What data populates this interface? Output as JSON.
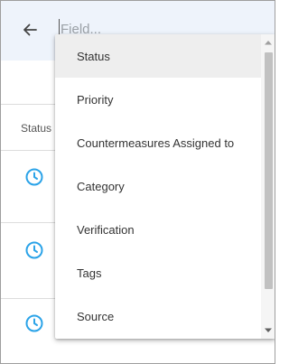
{
  "search": {
    "placeholder": "Field..."
  },
  "table": {
    "column_header": "Status"
  },
  "dropdown": {
    "items": [
      {
        "label": "Status"
      },
      {
        "label": "Priority"
      },
      {
        "label": "Countermeasures Assigned to"
      },
      {
        "label": "Category"
      },
      {
        "label": "Verification"
      },
      {
        "label": "Tags"
      },
      {
        "label": "Source"
      }
    ],
    "selected_index": 0
  },
  "colors": {
    "header_bg": "#eef3fb",
    "clock_icon": "#2ba3e8",
    "menu_highlight": "#eeeeee"
  },
  "icons": [
    "back-arrow-icon",
    "clock-icon",
    "scroll-up-arrow-icon",
    "scroll-down-arrow-icon"
  ]
}
